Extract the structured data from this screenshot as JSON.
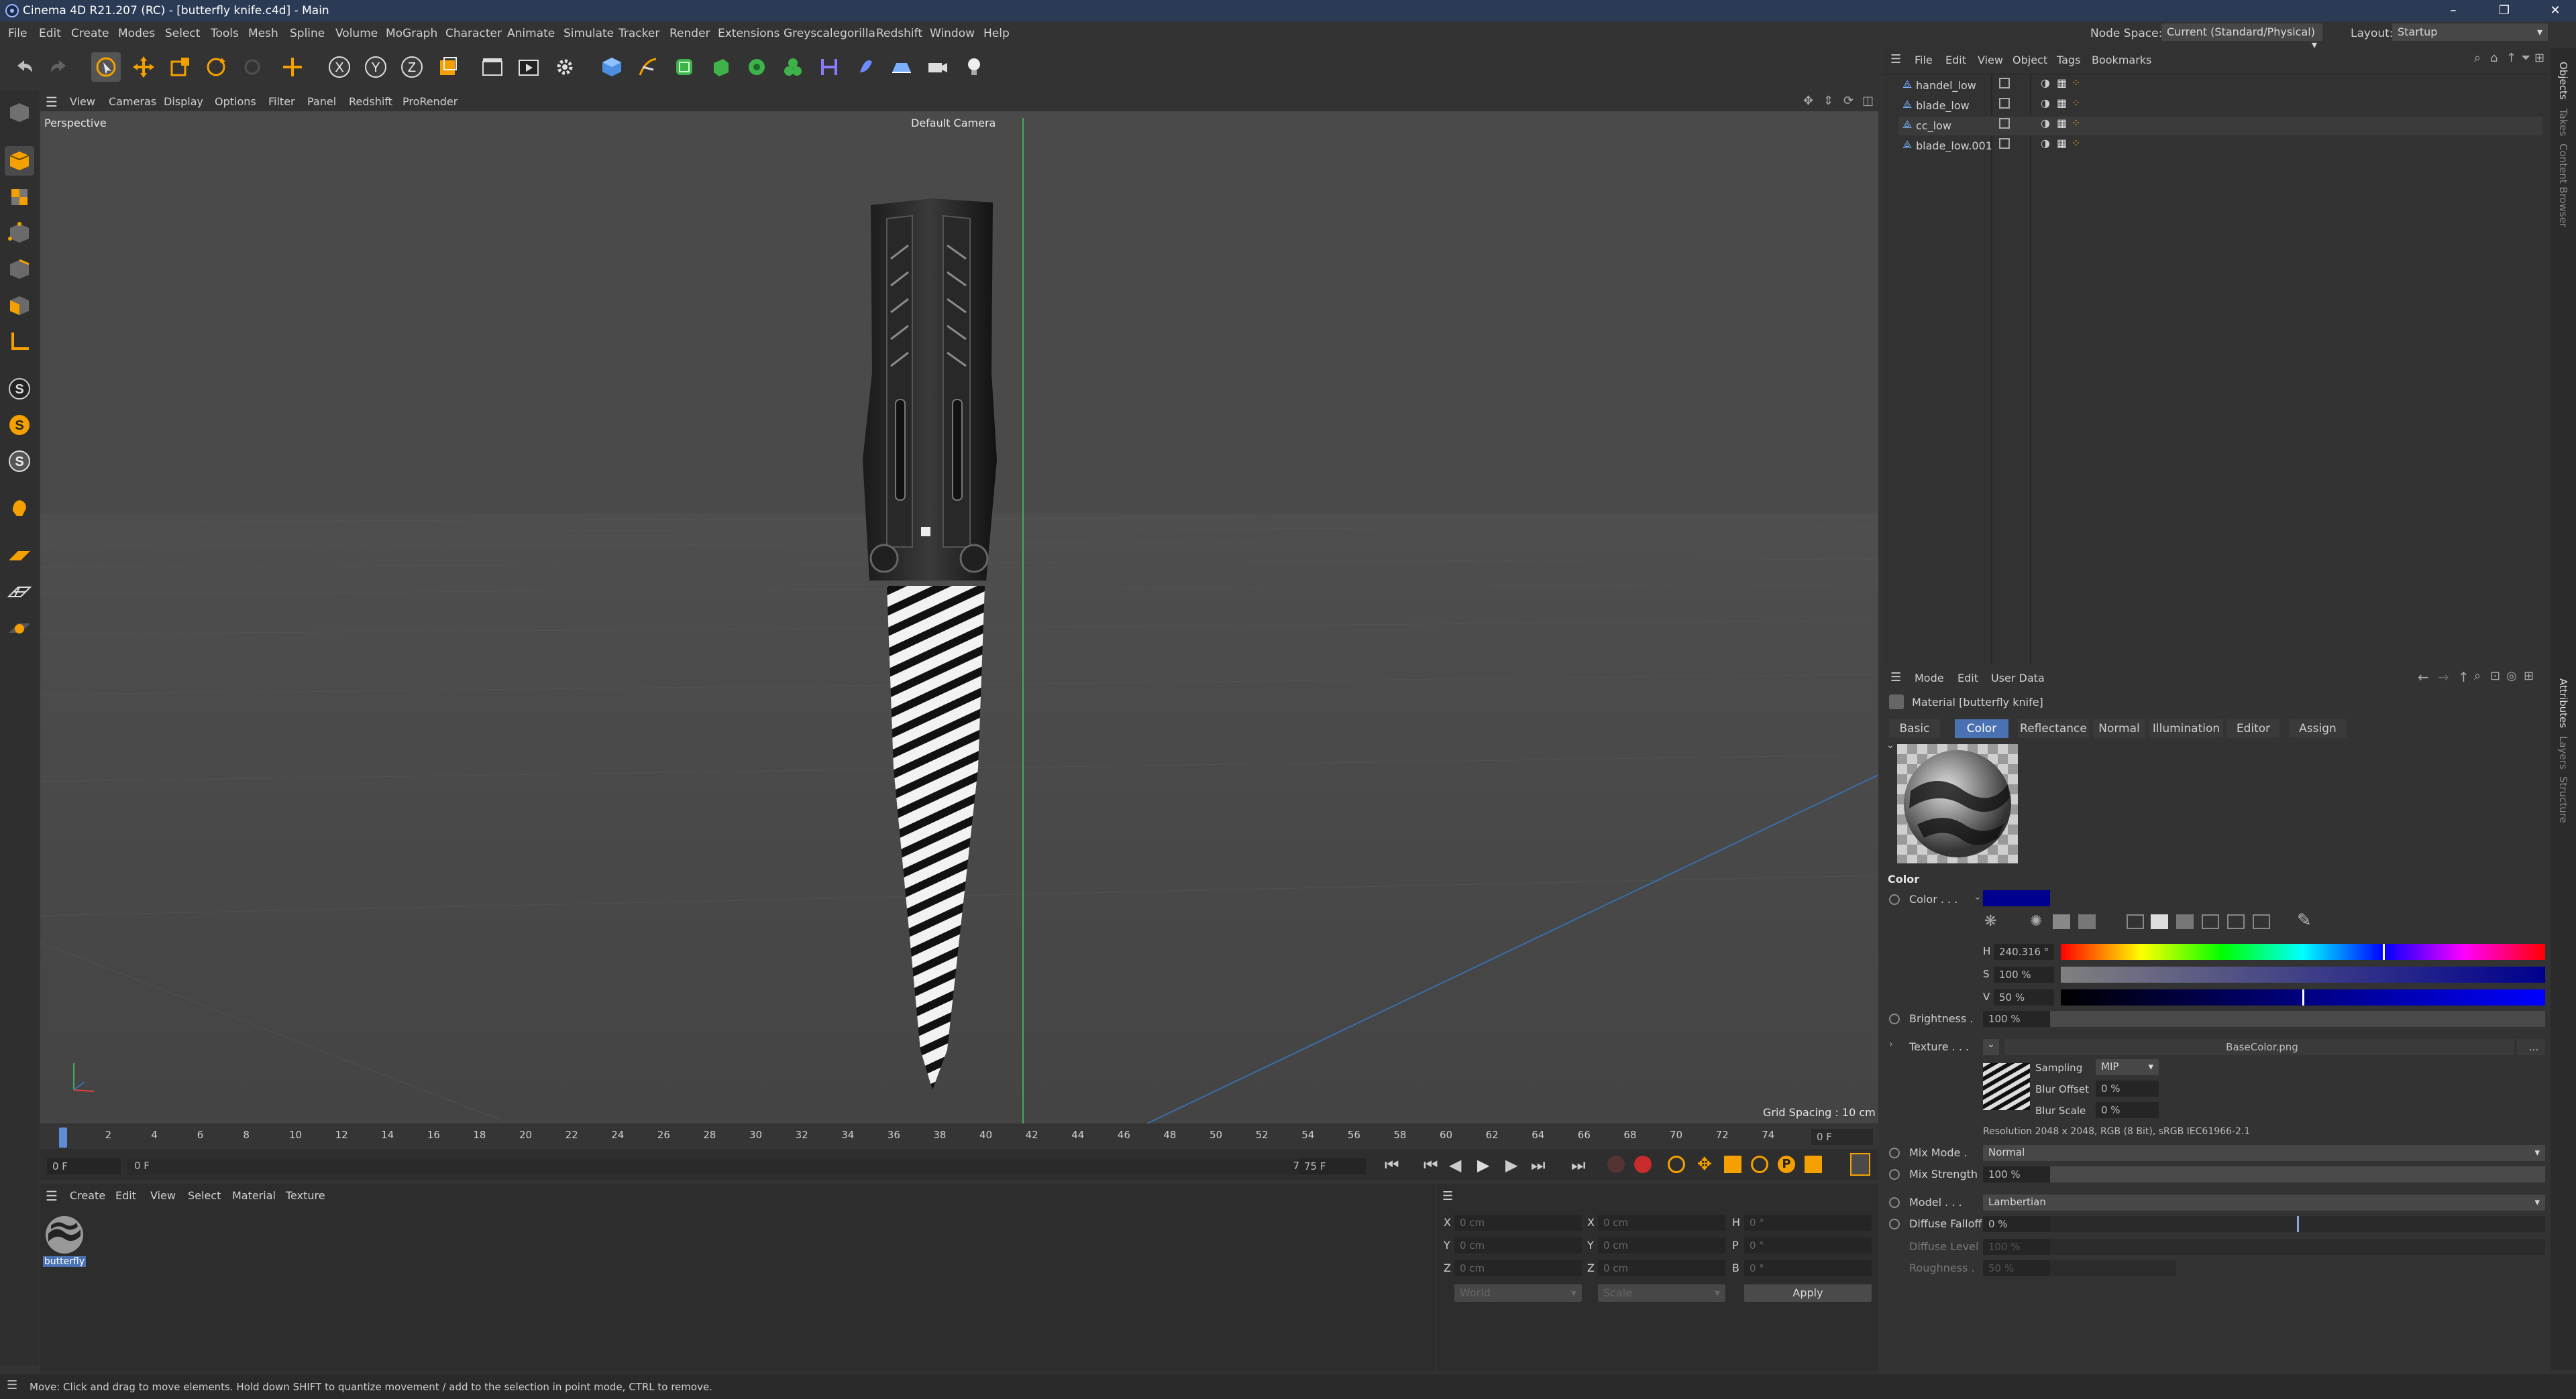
{
  "window": {
    "title": "Cinema 4D R21.207 (RC) - [butterfly knife.c4d] - Main",
    "minimize": "–",
    "restore": "❐",
    "close": "✕"
  },
  "menubar": {
    "items": [
      "File",
      "Edit",
      "Create",
      "Modes",
      "Select",
      "Tools",
      "Mesh",
      "Spline",
      "Volume",
      "MoGraph",
      "Character",
      "Animate",
      "Simulate",
      "Tracker",
      "Render",
      "Extensions",
      "Greyscalegorilla",
      "Redshift",
      "Window",
      "Help"
    ],
    "node_space_label": "Node Space:",
    "node_space_value": "Current (Standard/Physical)",
    "layout_label": "Layout:",
    "layout_value": "Startup"
  },
  "toolbar": {
    "axis_x": "X",
    "axis_y": "Y",
    "axis_z": "Z"
  },
  "viewport_menu": {
    "items": [
      "View",
      "Cameras",
      "Display",
      "Options",
      "Filter",
      "Panel",
      "Redshift",
      "ProRender"
    ]
  },
  "viewport": {
    "projection": "Perspective",
    "camera": "Default Camera",
    "grid_spacing": "Grid Spacing : 10 cm"
  },
  "timeline": {
    "ticks": [
      "0",
      "2",
      "4",
      "6",
      "8",
      "10",
      "12",
      "14",
      "16",
      "18",
      "20",
      "22",
      "24",
      "26",
      "28",
      "30",
      "32",
      "34",
      "36",
      "38",
      "40",
      "42",
      "44",
      "46",
      "48",
      "50",
      "52",
      "54",
      "56",
      "58",
      "60",
      "62",
      "64",
      "66",
      "68",
      "70",
      "72",
      "74"
    ],
    "current_frame": "0 F",
    "start_field": "0 F",
    "min_field": "0 F",
    "max_field": "75 F",
    "end_field": "75 F"
  },
  "material_manager": {
    "menu": [
      "Create",
      "Edit",
      "View",
      "Select",
      "Material",
      "Texture"
    ],
    "materials": [
      {
        "name": "butterfly"
      }
    ]
  },
  "coordinates": {
    "rows": [
      {
        "a": "X",
        "av": "0 cm",
        "b": "X",
        "bv": "0 cm",
        "c": "H",
        "cv": "0 °"
      },
      {
        "a": "Y",
        "av": "0 cm",
        "b": "Y",
        "bv": "0 cm",
        "c": "P",
        "cv": "0 °"
      },
      {
        "a": "Z",
        "av": "0 cm",
        "b": "Z",
        "bv": "0 cm",
        "c": "B",
        "cv": "0 °"
      }
    ],
    "space": "World",
    "mode": "Scale",
    "apply": "Apply"
  },
  "object_manager": {
    "menu": [
      "File",
      "Edit",
      "View",
      "Object",
      "Tags",
      "Bookmarks"
    ],
    "objects": [
      {
        "name": "handel_low"
      },
      {
        "name": "blade_low"
      },
      {
        "name": "cc_low"
      },
      {
        "name": "blade_low.001"
      }
    ]
  },
  "attributes": {
    "menu": [
      "Mode",
      "Edit",
      "User Data"
    ],
    "header": "Material [butterfly knife]",
    "tabs": [
      "Basic",
      "Color",
      "Reflectance",
      "Normal",
      "Illumination",
      "Editor",
      "Assign"
    ],
    "active_tab": "Color",
    "section": "Color",
    "color_label": "Color . . .",
    "color_hex": "#00008f",
    "h_label": "H",
    "h_value": "240.316 °",
    "s_label": "S",
    "s_value": "100 %",
    "v_label": "V",
    "v_value": "50 %",
    "brightness_label": "Brightness .",
    "brightness_value": "100 %",
    "brightness_fraction": 1.0,
    "texture_label": "Texture . . .",
    "texture_file": "BaseColor.png",
    "texture_more": "...",
    "sampling_label": "Sampling",
    "sampling_value": "MIP",
    "blur_offset_label": "Blur Offset",
    "blur_offset_value": "0 %",
    "blur_scale_label": "Blur Scale",
    "blur_scale_value": "0 %",
    "resolution": "Resolution 2048 x 2048, RGB (8 Bit), sRGB IEC61966-2.1",
    "mix_mode_label": "Mix Mode .",
    "mix_mode_value": "Normal",
    "mix_strength_label": "Mix Strength",
    "mix_strength_value": "100 %",
    "model_label": "Model . . .",
    "model_value": "Lambertian",
    "diffuse_falloff_label": "Diffuse Falloff",
    "diffuse_falloff_value": "0 %",
    "diffuse_level_label": "Diffuse Level",
    "diffuse_level_value": "100 %",
    "roughness_label": "Roughness .",
    "roughness_value": "50 %"
  },
  "right_strip": {
    "top": [
      "Objects",
      "Takes",
      "Content Browser"
    ],
    "bottom": [
      "Attributes",
      "Layers",
      "Structure"
    ]
  },
  "status": {
    "text": "Move: Click and drag to move elements. Hold down SHIFT to quantize movement / add to the selection in point mode, CTRL to remove."
  },
  "colors": {
    "accent": "#4a72b3",
    "title_bar": "#2c3b55",
    "viewport_bg": "#4a4a4a"
  }
}
